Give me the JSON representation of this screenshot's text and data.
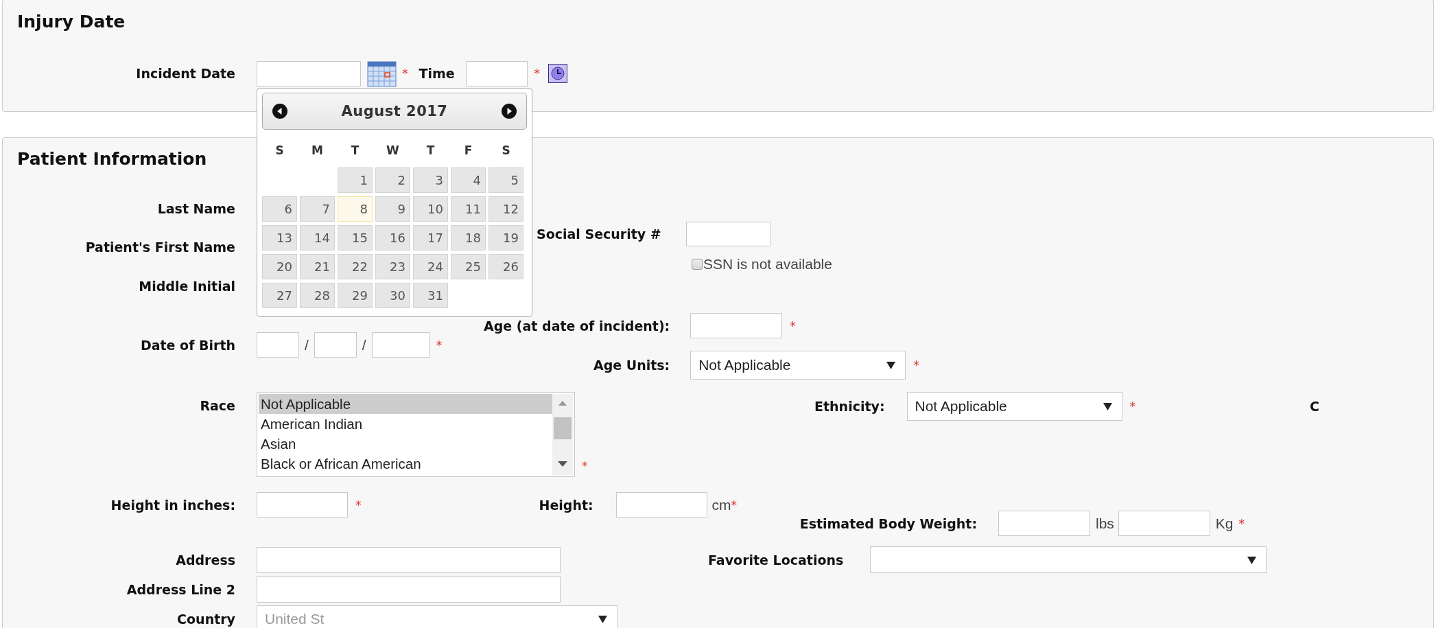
{
  "injury_date": {
    "title": "Injury Date",
    "incident_date": {
      "label": "Incident Date",
      "required_mark": "*"
    },
    "time": {
      "label": "Time",
      "required_mark": "*"
    }
  },
  "calendar": {
    "month": "August 2017",
    "weekdays": [
      "S",
      "M",
      "T",
      "W",
      "T",
      "F",
      "S"
    ],
    "weeks": [
      [
        {
          "kind": "blank"
        },
        {
          "kind": "blank"
        },
        {
          "kind": "day",
          "label": "1",
          "today": false
        },
        {
          "kind": "day",
          "label": "2",
          "today": false
        },
        {
          "kind": "day",
          "label": "3",
          "today": false
        },
        {
          "kind": "day",
          "label": "4",
          "today": false
        },
        {
          "kind": "day",
          "label": "5",
          "today": false
        }
      ],
      [
        {
          "kind": "day",
          "label": "6",
          "today": false
        },
        {
          "kind": "day",
          "label": "7",
          "today": false
        },
        {
          "kind": "day",
          "label": "8",
          "today": true
        },
        {
          "kind": "day",
          "label": "9",
          "today": false
        },
        {
          "kind": "day",
          "label": "10",
          "today": false
        },
        {
          "kind": "day",
          "label": "11",
          "today": false
        },
        {
          "kind": "day",
          "label": "12",
          "today": false
        }
      ],
      [
        {
          "kind": "day",
          "label": "13",
          "today": false
        },
        {
          "kind": "day",
          "label": "14",
          "today": false
        },
        {
          "kind": "day",
          "label": "15",
          "today": false
        },
        {
          "kind": "day",
          "label": "16",
          "today": false
        },
        {
          "kind": "day",
          "label": "17",
          "today": false
        },
        {
          "kind": "day",
          "label": "18",
          "today": false
        },
        {
          "kind": "day",
          "label": "19",
          "today": false
        }
      ],
      [
        {
          "kind": "day",
          "label": "20",
          "today": false
        },
        {
          "kind": "day",
          "label": "21",
          "today": false
        },
        {
          "kind": "day",
          "label": "22",
          "today": false
        },
        {
          "kind": "day",
          "label": "23",
          "today": false
        },
        {
          "kind": "day",
          "label": "24",
          "today": false
        },
        {
          "kind": "day",
          "label": "25",
          "today": false
        },
        {
          "kind": "day",
          "label": "26",
          "today": false
        }
      ],
      [
        {
          "kind": "day",
          "label": "27",
          "today": false
        },
        {
          "kind": "day",
          "label": "28",
          "today": false
        },
        {
          "kind": "day",
          "label": "29",
          "today": false
        },
        {
          "kind": "day",
          "label": "30",
          "today": false
        },
        {
          "kind": "day",
          "label": "31",
          "today": false
        },
        {
          "kind": "blank"
        },
        {
          "kind": "blank"
        }
      ]
    ]
  },
  "patient": {
    "title": "Patient Information",
    "last_name": {
      "label": "Last Name"
    },
    "first_name": {
      "label": "Patient's First Name"
    },
    "middle_initial": {
      "label": "Middle Initial"
    },
    "ssn": {
      "label": "Social Security #",
      "not_available": {
        "label": "SSN is not available",
        "checked": false
      }
    },
    "age": {
      "label": "Age (at date of incident):",
      "required_mark": "*"
    },
    "date_of_birth": {
      "label": "Date of Birth",
      "separators": [
        "/",
        "/"
      ],
      "required_mark": "*"
    },
    "age_units": {
      "label": "Age Units:",
      "value": "Not Applicable",
      "required_mark": "*"
    },
    "race": {
      "label": "Race",
      "options": [
        {
          "label": "Not Applicable",
          "selected": true
        },
        {
          "label": "American Indian",
          "selected": false
        },
        {
          "label": "Asian",
          "selected": false
        },
        {
          "label": "Black or African American",
          "selected": false
        }
      ],
      "required_mark": "*"
    },
    "ethnicity": {
      "label": "Ethnicity:",
      "value": "Not Applicable",
      "required_mark": "*"
    },
    "column_3_label": "C",
    "height_inches": {
      "label": "Height in inches:",
      "required_mark": "*"
    },
    "height": {
      "label": "Height:",
      "unit": "cm",
      "required_mark": "*"
    },
    "body_weight": {
      "label": "Estimated Body Weight:",
      "units": [
        "lbs",
        "Kg"
      ],
      "required_mark": "*"
    },
    "address": {
      "label": "Address"
    },
    "address_line_2": {
      "label": "Address Line 2"
    },
    "favorite_locations": {
      "label": "Favorite Locations"
    },
    "country": {
      "label": "Country",
      "value": "United St"
    }
  }
}
